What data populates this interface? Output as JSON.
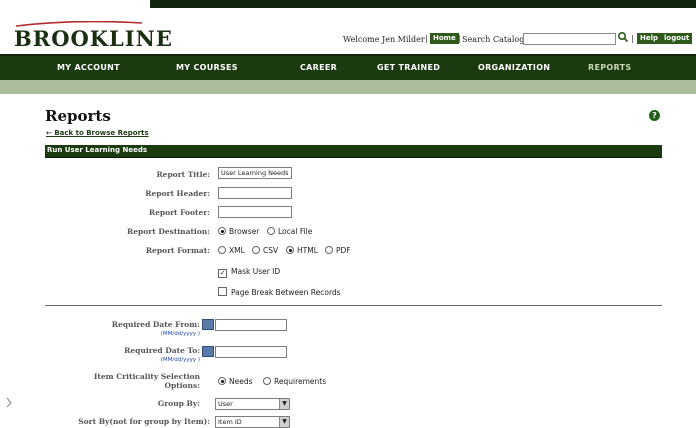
{
  "header": {
    "logo": "BROOKLINE",
    "welcome": "Welcome Jen Milder",
    "home_label": "Home",
    "search_label": "Search Catalog",
    "search_value": "",
    "help_label": "Help",
    "logout_label": "logout"
  },
  "nav": {
    "items": [
      {
        "label": "MY ACCOUNT"
      },
      {
        "label": "MY COURSES"
      },
      {
        "label": "CAREER"
      },
      {
        "label": "GET TRAINED"
      },
      {
        "label": "ORGANIZATION"
      },
      {
        "label": "REPORTS",
        "active": true
      }
    ]
  },
  "page": {
    "title": "Reports",
    "back_link": "Back to Browse Reports",
    "help_icon": "?"
  },
  "section": {
    "title": "Run User Learning Needs"
  },
  "form": {
    "report_title_label": "Report Title:",
    "report_title_value": "User Learning Needs",
    "report_header_label": "Report Header:",
    "report_header_value": "",
    "report_footer_label": "Report Footer:",
    "report_footer_value": "",
    "destination_label": "Report Destination:",
    "destination_options": [
      "Browser",
      "Local File"
    ],
    "destination_selected": "Browser",
    "format_label": "Report Format:",
    "format_options": [
      "XML",
      "CSV",
      "HTML",
      "PDF"
    ],
    "format_selected": "HTML",
    "mask_user_label": "Mask User ID",
    "mask_user_checked": true,
    "page_break_label": "Page Break Between Records",
    "page_break_checked": false,
    "required_from_label": "Required Date From:",
    "required_to_label": "Required Date To:",
    "date_hint": "(MM/dd/yyyy )",
    "criticality_label_1": "Item Criticality Selection",
    "criticality_label_2": "Options:",
    "criticality_options": [
      "Needs",
      "Requirements"
    ],
    "criticality_selected": "Needs",
    "group_by_label": "Group By:",
    "group_by_value": "User",
    "sort_by_label": "Sort By(not for group by Item):",
    "sort_by_value": "Item ID"
  },
  "colors": {
    "nav_bg": "#1b3a10",
    "subbar": "#a9bc9c",
    "button_green": "#2f5a1c"
  }
}
